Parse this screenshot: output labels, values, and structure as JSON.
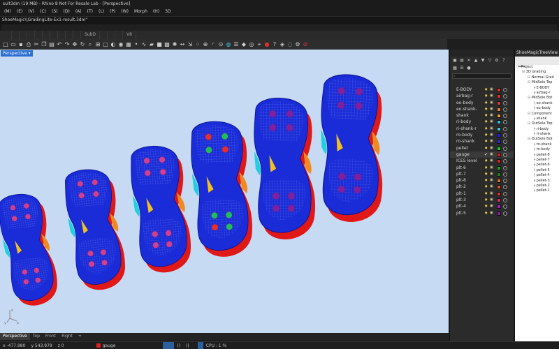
{
  "window": {
    "title": "sult3dm (19 MB) - Rhino 8 Not For Resale Lab - [Perspective]"
  },
  "menu": [
    "(M)",
    "(E)",
    "(V)",
    "(C)",
    "(S)",
    "(D)",
    "(A)",
    "(T)",
    "(L)",
    "(P)",
    "(W)",
    "Morph",
    "(H)",
    "3D"
  ],
  "command": {
    "history": "ShoeMagic\\\\GradingLite-Ex1-result.3dm\"",
    "prompt": ""
  },
  "toolbar_tabs": [
    "",
    "",
    "",
    "",
    "",
    "",
    "",
    "",
    "",
    "",
    "SubD",
    "",
    "",
    "",
    "V8"
  ],
  "toolbar_icons": [
    "new-icon",
    "open-icon",
    "save-icon",
    "print-icon",
    "cut-icon",
    "copy-icon",
    "paste-icon",
    "undo-icon",
    "redo-icon",
    "pan-icon",
    "rotate-icon",
    "zoom-icon",
    "zoom-extents-icon",
    "window-icon",
    "shade-icon",
    "render-icon",
    "grid-icon",
    "point-icon",
    "curve-icon",
    "surface-icon",
    "solid-icon",
    "mesh-icon",
    "light-icon",
    "dimension-icon",
    "transform-icon",
    "array-icon",
    "boolean-icon",
    "fillet-icon",
    "analyze-icon",
    "color-icon",
    "layer-icon",
    "object-icon",
    "camera-icon",
    "snap-icon",
    "record-icon",
    "help-icon",
    "material-icon",
    "env-icon",
    "settings-icon",
    "stop-icon"
  ],
  "viewport": {
    "label": "Perspective"
  },
  "layers_panel": {
    "title": "",
    "search_placeholder": "",
    "column_header": "",
    "layers": [
      {
        "name": "E-BODY",
        "color": "#e03030",
        "material": "#ffffff"
      },
      {
        "name": "airbag-r",
        "color": "#e03030",
        "material": "#ffffff"
      },
      {
        "name": "eo-body",
        "color": "#d04040",
        "material": "#ffffff"
      },
      {
        "name": "eo-shank-",
        "color": "#e08040",
        "material": "#ffffff"
      },
      {
        "name": "shank",
        "color": "#e0a020",
        "material": "#ffffff"
      },
      {
        "name": "ri-body",
        "color": "#20c0e0",
        "material": "#ffffff"
      },
      {
        "name": "ri-shank-r",
        "color": "#30d0d0",
        "material": "#ffffff"
      },
      {
        "name": "ro-body",
        "color": "#2020e0",
        "material": "#ffffff"
      },
      {
        "name": "ro-shank",
        "color": "#3030d0",
        "material": "#ffffff"
      },
      {
        "name": "pellet",
        "color": "#20c020",
        "material": "#ffffff"
      },
      {
        "name": "gauge",
        "color": "#e02020",
        "material": "#ffffff",
        "current": true
      },
      {
        "name": "ICES level",
        "color": "#e02020",
        "material": "#ffffff"
      },
      {
        "name": "plt-6",
        "color": "#20a020",
        "material": "#ffffff"
      },
      {
        "name": "plt-7",
        "color": "#208020",
        "material": "#ffffff"
      },
      {
        "name": "plt-8",
        "color": "#e07020",
        "material": "#ffffff"
      },
      {
        "name": "plt-2",
        "color": "#e05020",
        "material": "#ffffff"
      },
      {
        "name": "plt-1",
        "color": "#e03030",
        "material": "#ffffff"
      },
      {
        "name": "plt-3",
        "color": "#d03060",
        "material": "#ffffff"
      },
      {
        "name": "plt-4",
        "color": "#a020c0",
        "material": "#ffffff"
      },
      {
        "name": "plt-5",
        "color": "#8020a0",
        "material": "#ffffff"
      }
    ]
  },
  "tree_panel": {
    "title": "ShoeMagicTreeView",
    "tab": "",
    "items": [
      {
        "text": "Project",
        "indent": 0
      },
      {
        "text": "3D Grading",
        "indent": 1
      },
      {
        "text": "Normal Grad",
        "indent": 2
      },
      {
        "text": "MidSole Top",
        "indent": 2
      },
      {
        "text": "E-BODY",
        "indent": 3
      },
      {
        "text": "airbag-r",
        "indent": 3
      },
      {
        "text": "MidSole Bot",
        "indent": 2
      },
      {
        "text": "eo-shank",
        "indent": 3
      },
      {
        "text": "eo-body",
        "indent": 3
      },
      {
        "text": "Component",
        "indent": 2
      },
      {
        "text": "shank",
        "indent": 3
      },
      {
        "text": "OutSole Top",
        "indent": 2
      },
      {
        "text": "ri-body",
        "indent": 3
      },
      {
        "text": "ri-shank",
        "indent": 3
      },
      {
        "text": "OutSole Bot",
        "indent": 2
      },
      {
        "text": "ro-shank",
        "indent": 3
      },
      {
        "text": "ro-body",
        "indent": 3
      },
      {
        "text": "pellet-8",
        "indent": 3
      },
      {
        "text": "pellet-7",
        "indent": 3
      },
      {
        "text": "pellet-6",
        "indent": 3
      },
      {
        "text": "pellet-5",
        "indent": 3
      },
      {
        "text": "pellet-4",
        "indent": 3
      },
      {
        "text": "pellet-3",
        "indent": 3
      },
      {
        "text": "pellet-2",
        "indent": 3
      },
      {
        "text": "pellet-1",
        "indent": 3
      }
    ]
  },
  "viewport_tabs": [
    {
      "label": "Perspective",
      "active": true
    },
    {
      "label": "Top",
      "active": false
    },
    {
      "label": "Front",
      "active": false
    },
    {
      "label": "Right",
      "active": false
    },
    {
      "label": "+",
      "active": false
    }
  ],
  "status": {
    "x": "x -477.980",
    "y": "y 543.979",
    "z": "z 0",
    "units": "",
    "layer": "gauge",
    "layer_color": "#e02020",
    "toggles": [
      {
        "label": "",
        "on": false
      },
      {
        "label": "",
        "on": false
      },
      {
        "label": "",
        "on": false
      },
      {
        "label": "",
        "on": true
      },
      {
        "label": "",
        "on": true
      },
      {
        "label": "()",
        "on": false
      },
      {
        "label": "()",
        "on": false
      },
      {
        "label": "",
        "on": false
      },
      {
        "label": "",
        "on": true
      }
    ],
    "cpu": "CPU : 1 %"
  }
}
